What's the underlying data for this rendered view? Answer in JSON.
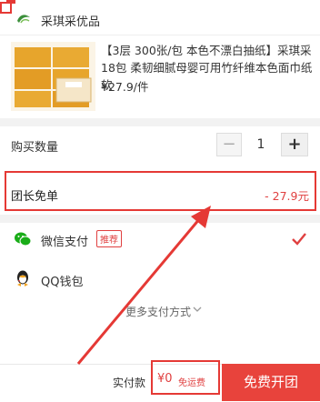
{
  "store": {
    "name": "采琪采优品"
  },
  "product": {
    "title": "【3层 300张/包 本色不漂白抽纸】采琪采18包 柔韧细腻母婴可用竹纤维本色面巾纸 软",
    "price": "¥27.9/件"
  },
  "quantity": {
    "label": "购买数量",
    "minus": "−",
    "value": "1",
    "plus": "+"
  },
  "leader_discount": {
    "label": "团长免单",
    "value": "- 27.9元"
  },
  "payment": {
    "wechat": {
      "label": "微信支付",
      "badge": "推荐",
      "selected": true
    },
    "qq": {
      "label": "QQ钱包"
    },
    "more": "更多支付方式"
  },
  "footer": {
    "pay_label": "实付款",
    "amount": "¥0",
    "shipping": "免运费",
    "cta": "免费开团"
  },
  "colors": {
    "accent": "#e8433c",
    "highlight": "#e53935",
    "wechat": "#1aad19",
    "qq": "#222222"
  }
}
